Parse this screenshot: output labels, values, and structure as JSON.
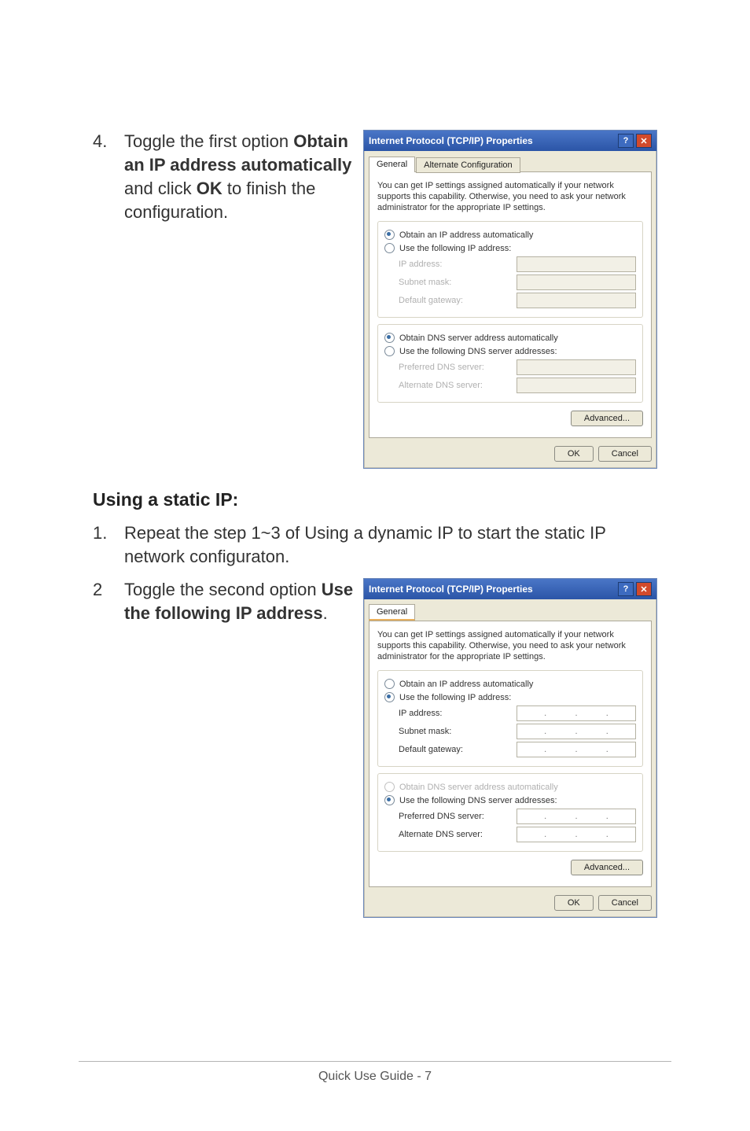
{
  "step4": {
    "num": "4.",
    "text_before_bold1": "Toggle the first option ",
    "bold1": "Obtain an IP address automatically",
    "text_mid": " and click ",
    "bold2": "OK",
    "text_after": " to finish the configuration."
  },
  "heading1": "Using a static IP:",
  "step1": {
    "num": "1.",
    "text": "Repeat the step 1~3 of Using a dynamic IP to start the static IP network configuraton."
  },
  "step2": {
    "num": "2",
    "text_before_bold": "Toggle the second option ",
    "bold": "Use the following IP address",
    "text_after": "."
  },
  "dialogA": {
    "title": "Internet Protocol (TCP/IP) Properties",
    "tabs": {
      "general": "General",
      "alt": "Alternate Configuration"
    },
    "desc": "You can get IP settings assigned automatically if your network supports this capability. Otherwise, you need to ask your network administrator for the appropriate IP settings.",
    "opt_auto_ip": "Obtain an IP address automatically",
    "opt_use_ip": "Use the following IP address:",
    "lbl_ip": "IP address:",
    "lbl_mask": "Subnet mask:",
    "lbl_gw": "Default gateway:",
    "opt_auto_dns": "Obtain DNS server address automatically",
    "opt_use_dns": "Use the following DNS server addresses:",
    "lbl_pdns": "Preferred DNS server:",
    "lbl_adns": "Alternate DNS server:",
    "btn_adv": "Advanced...",
    "btn_ok": "OK",
    "btn_cancel": "Cancel"
  },
  "dialogB": {
    "title": "Internet Protocol (TCP/IP) Properties",
    "tabs": {
      "general": "General"
    },
    "desc": "You can get IP settings assigned automatically if your network supports this capability. Otherwise, you need to ask your network administrator for the appropriate IP settings.",
    "opt_auto_ip": "Obtain an IP address automatically",
    "opt_use_ip": "Use the following IP address:",
    "lbl_ip": "IP address:",
    "lbl_mask": "Subnet mask:",
    "lbl_gw": "Default gateway:",
    "opt_auto_dns": "Obtain DNS server address automatically",
    "opt_use_dns": "Use the following DNS server addresses:",
    "lbl_pdns": "Preferred DNS server:",
    "lbl_adns": "Alternate DNS server:",
    "btn_adv": "Advanced...",
    "btn_ok": "OK",
    "btn_cancel": "Cancel"
  },
  "footer": "Quick Use Guide - 7"
}
